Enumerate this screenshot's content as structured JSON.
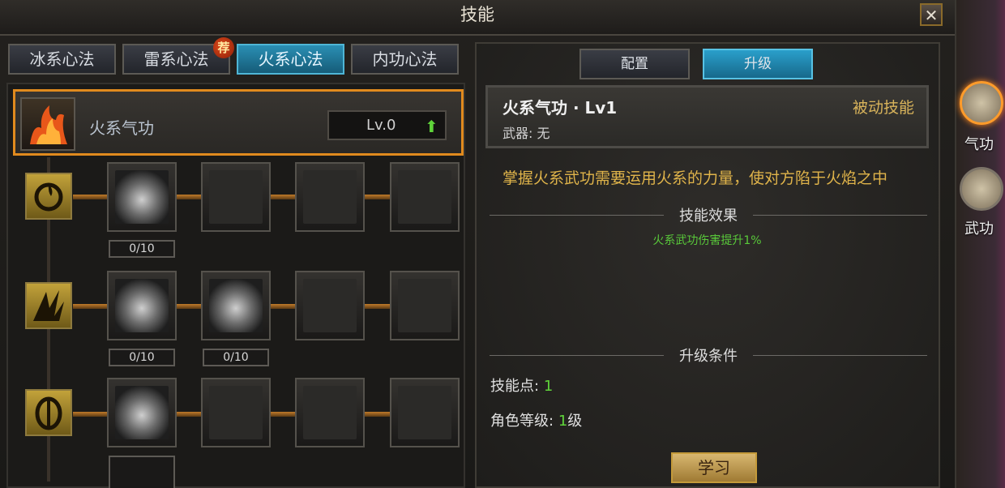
{
  "window": {
    "title": "技能",
    "close_label": "✕"
  },
  "tabs": [
    {
      "label": "冰系心法",
      "active": false
    },
    {
      "label": "雷系心法",
      "active": false,
      "badge": "荐"
    },
    {
      "label": "火系心法",
      "active": true
    },
    {
      "label": "内功心法",
      "active": false
    }
  ],
  "skill_header": {
    "name": "火系气功",
    "level": "Lv.0",
    "upgrade_icon": "green-up-arrow-icon"
  },
  "tree": {
    "row1": {
      "counts": [
        "0/10"
      ]
    },
    "row2": {
      "counts": [
        "0/10",
        "0/10"
      ]
    }
  },
  "right_tabs": [
    {
      "label": "配置",
      "active": false
    },
    {
      "label": "升级",
      "active": true
    }
  ],
  "detail": {
    "title": "火系气功 · Lv1",
    "type": "被动技能",
    "weapon_label": "武器: 无",
    "description": "掌握火系武功需要运用火系的力量，使对方陷于火焰之中",
    "effect_header": "技能效果",
    "effect": "火系武功伤害提升1%",
    "condition_header": "升级条件",
    "skill_points_label": "技能点:",
    "skill_points_value": "1",
    "role_level_label": "角色等级:",
    "role_level_value": "1",
    "role_level_unit": "级",
    "learn_button": "学习"
  },
  "sidebar": [
    {
      "label": "气功",
      "active": true
    },
    {
      "label": "武功",
      "active": false
    }
  ],
  "colors": {
    "accent_orange": "#e08a1e",
    "active_tab": "#2a8fb4",
    "positive": "#5fd43a",
    "gold_text": "#d8b35b"
  }
}
